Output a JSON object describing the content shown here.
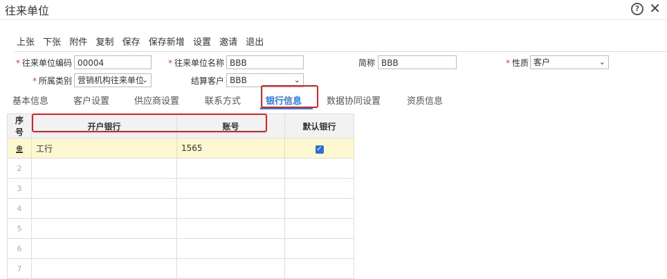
{
  "window": {
    "title": "往来单位"
  },
  "toolbar": {
    "items": [
      "上张",
      "下张",
      "附件",
      "复制",
      "保存",
      "保存新增",
      "设置",
      "邀请",
      "退出"
    ]
  },
  "form": {
    "code_label": "往来单位编码",
    "code_value": "00004",
    "name_label": "往来单位名称",
    "name_value": "BBB",
    "short_label": "简称",
    "short_value": "BBB",
    "nature_label": "性质",
    "nature_value": "客户",
    "category_label": "所属类别",
    "category_value": "营销机构往来单位",
    "settle_label": "结算客户",
    "settle_value": "BBB"
  },
  "tabs": [
    "基本信息",
    "客户设置",
    "供应商设置",
    "联系方式",
    "银行信息",
    "数据协同设置",
    "资质信息"
  ],
  "active_tab": "银行信息",
  "grid": {
    "headers": [
      "序号",
      "开户银行",
      "账号",
      "默认银行"
    ],
    "rows": [
      {
        "bank": "工行",
        "account": "1565",
        "default": true
      }
    ],
    "row_numbers": [
      "2",
      "3",
      "4",
      "5",
      "6",
      "7"
    ]
  }
}
